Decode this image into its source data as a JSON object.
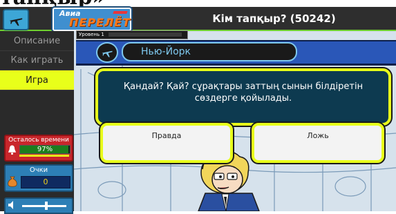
{
  "page_heading": "тапқыр»",
  "header": {
    "logo_line1": "Авиа",
    "logo_line2": "ПЕРЕЛЁТ",
    "title": "Кім тапқыр? (50242)"
  },
  "sidebar": {
    "items": [
      {
        "label": "Описание",
        "active": false
      },
      {
        "label": "Как играть",
        "active": false
      },
      {
        "label": "Игра",
        "active": true
      }
    ],
    "time": {
      "label": "Осталось времени",
      "value": "97%",
      "fraction": 0.97
    },
    "score": {
      "label": "Очки",
      "value": "0"
    },
    "volume": {
      "level": 0.55
    }
  },
  "game": {
    "level_label": "Уровень 1",
    "city": "Нью-Йорк",
    "question": "Қандай? Қай? сұрақтары заттың сынын білдіретін сөздерге қойылады.",
    "answers": [
      {
        "label": "Правда"
      },
      {
        "label": "Ложь"
      }
    ]
  },
  "colors": {
    "accent": "#e8ff1a",
    "topbar": "#2e2e2e",
    "question_bg": "#0d3a50",
    "city_band": "#2a57b8",
    "time_panel": "#c9262b",
    "score_panel": "#2d7fb6"
  },
  "icons": [
    "plane-icon",
    "bell-icon",
    "moneybag-icon",
    "speaker-icon"
  ]
}
